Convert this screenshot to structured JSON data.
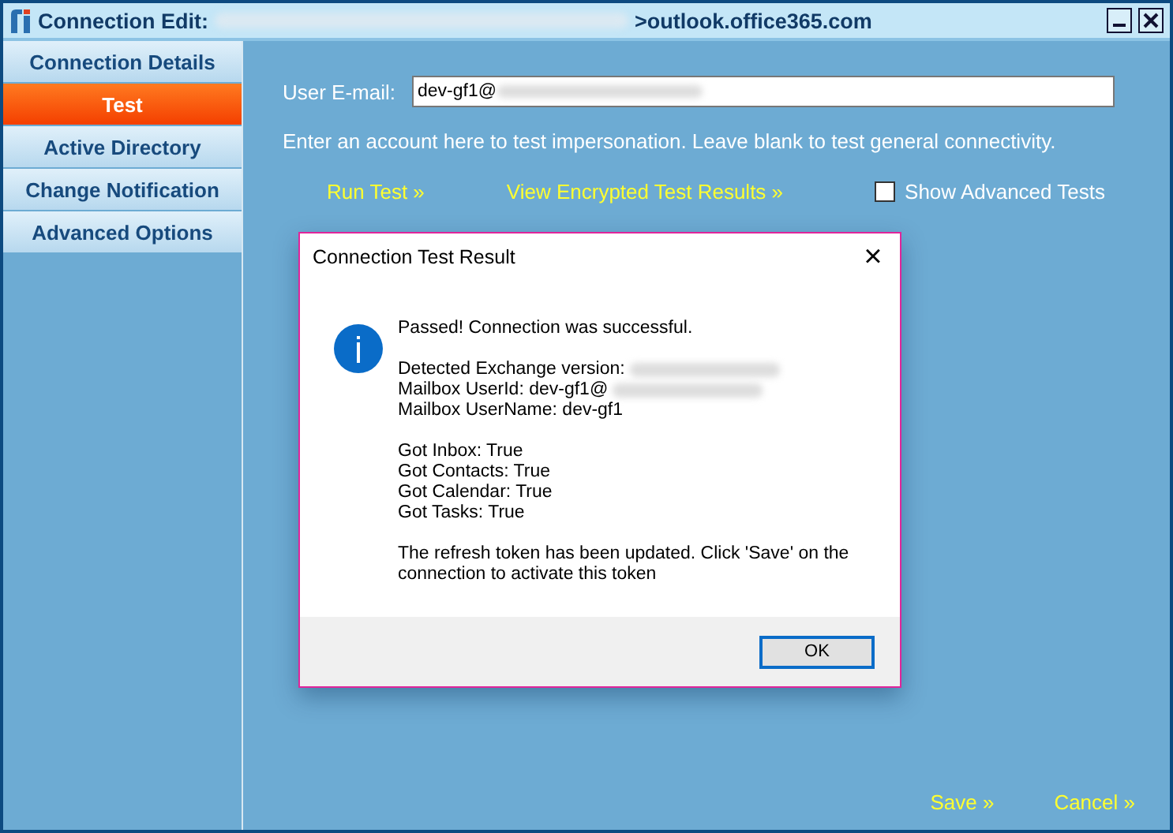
{
  "window": {
    "title_prefix": "Connection  Edit:",
    "title_suffix": ">outlook.office365.com"
  },
  "sidebar": {
    "items": [
      {
        "label": "Connection Details",
        "selected": false
      },
      {
        "label": "Test",
        "selected": true
      },
      {
        "label": "Active Directory",
        "selected": false
      },
      {
        "label": "Change Notification",
        "selected": false
      },
      {
        "label": "Advanced Options",
        "selected": false
      }
    ]
  },
  "form": {
    "email_label": "User E-mail:",
    "email_value": "dev-gf1@",
    "hint": "Enter an account here to test impersonation. Leave blank to test general connectivity.",
    "run_test": "Run Test »",
    "view_results": "View Encrypted Test Results »",
    "advanced": {
      "label": "Show Advanced Tests",
      "checked": false
    }
  },
  "dialog": {
    "title": "Connection Test Result",
    "close": "×",
    "paragraphs": [
      [
        {
          "text": "Passed! Connection was successful.",
          "kind": "plain"
        }
      ],
      [
        {
          "text": "Detected Exchange version:",
          "kind": "redacted"
        },
        {
          "text": "Mailbox UserId: dev-gf1@",
          "kind": "redacted"
        },
        {
          "text": "Mailbox UserName: dev-gf1",
          "kind": "plain"
        }
      ],
      [
        {
          "text": "Got Inbox: True",
          "kind": "plain"
        },
        {
          "text": "Got Contacts: True",
          "kind": "plain"
        },
        {
          "text": "Got Calendar: True",
          "kind": "plain"
        },
        {
          "text": "Got Tasks: True",
          "kind": "plain"
        }
      ],
      [
        {
          "text": "The refresh token has been updated. Click 'Save' on the connection to activate this token",
          "kind": "plain"
        }
      ]
    ],
    "ok": "OK"
  },
  "footer": {
    "save": "Save »",
    "cancel": "Cancel »"
  }
}
